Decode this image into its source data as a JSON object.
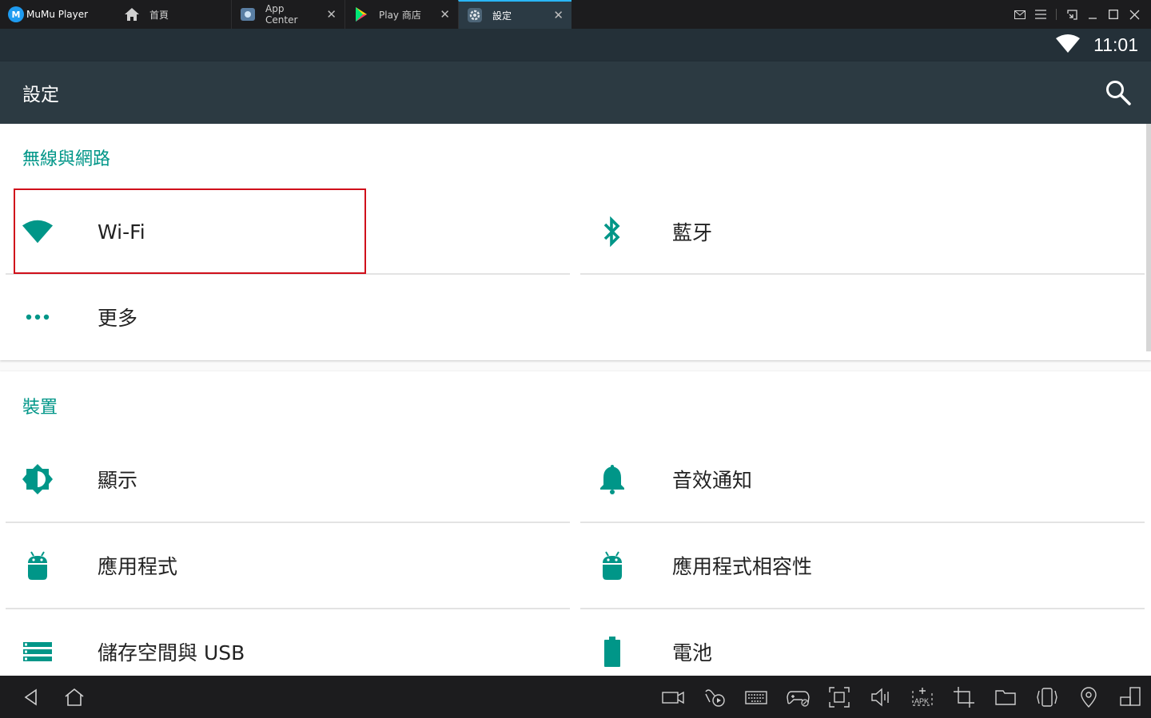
{
  "titlebar": {
    "logo_text": "MuMu Player",
    "tabs": [
      {
        "label": "首頁"
      },
      {
        "label": "App Center"
      },
      {
        "label": "Play 商店"
      },
      {
        "label": "設定"
      }
    ]
  },
  "statusbar": {
    "time": "11:01"
  },
  "actionbar": {
    "title": "設定"
  },
  "sections": {
    "wireless": {
      "title": "無線與網路",
      "items": [
        {
          "label": "Wi-Fi"
        },
        {
          "label": "藍牙"
        },
        {
          "label": "更多"
        }
      ]
    },
    "device": {
      "title": "裝置",
      "items": [
        {
          "label": "顯示"
        },
        {
          "label": "音效通知"
        },
        {
          "label": "應用程式"
        },
        {
          "label": "應用程式相容性"
        },
        {
          "label": "儲存空間與 USB"
        },
        {
          "label": "電池"
        }
      ]
    }
  },
  "colors": {
    "accent": "#009688",
    "actionbar": "#2c3a42",
    "statusbar": "#243038",
    "highlight": "#d0101b"
  }
}
